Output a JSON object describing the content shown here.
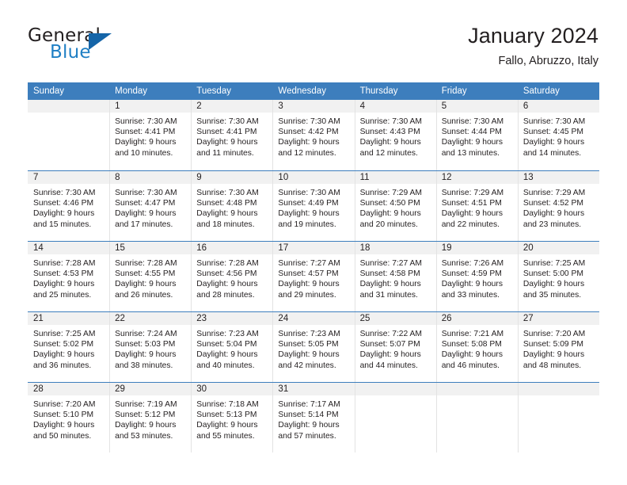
{
  "brand": {
    "name_part1": "General",
    "name_part2": "Blue",
    "triangle_color": "#1565a8",
    "blue_color": "#1f7fc4"
  },
  "header": {
    "title": "January 2024",
    "subtitle": "Fallo, Abruzzo, Italy"
  },
  "theme": {
    "header_blue": "#3d7ebd",
    "numbar_gray": "#f1f1f1",
    "text": "#231f20"
  },
  "weekday_headers": [
    "Sunday",
    "Monday",
    "Tuesday",
    "Wednesday",
    "Thursday",
    "Friday",
    "Saturday"
  ],
  "weeks": [
    [
      {
        "day": "",
        "sunrise": "",
        "sunset": "",
        "daylight1": "",
        "daylight2": ""
      },
      {
        "day": "1",
        "sunrise": "Sunrise: 7:30 AM",
        "sunset": "Sunset: 4:41 PM",
        "daylight1": "Daylight: 9 hours",
        "daylight2": "and 10 minutes."
      },
      {
        "day": "2",
        "sunrise": "Sunrise: 7:30 AM",
        "sunset": "Sunset: 4:41 PM",
        "daylight1": "Daylight: 9 hours",
        "daylight2": "and 11 minutes."
      },
      {
        "day": "3",
        "sunrise": "Sunrise: 7:30 AM",
        "sunset": "Sunset: 4:42 PM",
        "daylight1": "Daylight: 9 hours",
        "daylight2": "and 12 minutes."
      },
      {
        "day": "4",
        "sunrise": "Sunrise: 7:30 AM",
        "sunset": "Sunset: 4:43 PM",
        "daylight1": "Daylight: 9 hours",
        "daylight2": "and 12 minutes."
      },
      {
        "day": "5",
        "sunrise": "Sunrise: 7:30 AM",
        "sunset": "Sunset: 4:44 PM",
        "daylight1": "Daylight: 9 hours",
        "daylight2": "and 13 minutes."
      },
      {
        "day": "6",
        "sunrise": "Sunrise: 7:30 AM",
        "sunset": "Sunset: 4:45 PM",
        "daylight1": "Daylight: 9 hours",
        "daylight2": "and 14 minutes."
      }
    ],
    [
      {
        "day": "7",
        "sunrise": "Sunrise: 7:30 AM",
        "sunset": "Sunset: 4:46 PM",
        "daylight1": "Daylight: 9 hours",
        "daylight2": "and 15 minutes."
      },
      {
        "day": "8",
        "sunrise": "Sunrise: 7:30 AM",
        "sunset": "Sunset: 4:47 PM",
        "daylight1": "Daylight: 9 hours",
        "daylight2": "and 17 minutes."
      },
      {
        "day": "9",
        "sunrise": "Sunrise: 7:30 AM",
        "sunset": "Sunset: 4:48 PM",
        "daylight1": "Daylight: 9 hours",
        "daylight2": "and 18 minutes."
      },
      {
        "day": "10",
        "sunrise": "Sunrise: 7:30 AM",
        "sunset": "Sunset: 4:49 PM",
        "daylight1": "Daylight: 9 hours",
        "daylight2": "and 19 minutes."
      },
      {
        "day": "11",
        "sunrise": "Sunrise: 7:29 AM",
        "sunset": "Sunset: 4:50 PM",
        "daylight1": "Daylight: 9 hours",
        "daylight2": "and 20 minutes."
      },
      {
        "day": "12",
        "sunrise": "Sunrise: 7:29 AM",
        "sunset": "Sunset: 4:51 PM",
        "daylight1": "Daylight: 9 hours",
        "daylight2": "and 22 minutes."
      },
      {
        "day": "13",
        "sunrise": "Sunrise: 7:29 AM",
        "sunset": "Sunset: 4:52 PM",
        "daylight1": "Daylight: 9 hours",
        "daylight2": "and 23 minutes."
      }
    ],
    [
      {
        "day": "14",
        "sunrise": "Sunrise: 7:28 AM",
        "sunset": "Sunset: 4:53 PM",
        "daylight1": "Daylight: 9 hours",
        "daylight2": "and 25 minutes."
      },
      {
        "day": "15",
        "sunrise": "Sunrise: 7:28 AM",
        "sunset": "Sunset: 4:55 PM",
        "daylight1": "Daylight: 9 hours",
        "daylight2": "and 26 minutes."
      },
      {
        "day": "16",
        "sunrise": "Sunrise: 7:28 AM",
        "sunset": "Sunset: 4:56 PM",
        "daylight1": "Daylight: 9 hours",
        "daylight2": "and 28 minutes."
      },
      {
        "day": "17",
        "sunrise": "Sunrise: 7:27 AM",
        "sunset": "Sunset: 4:57 PM",
        "daylight1": "Daylight: 9 hours",
        "daylight2": "and 29 minutes."
      },
      {
        "day": "18",
        "sunrise": "Sunrise: 7:27 AM",
        "sunset": "Sunset: 4:58 PM",
        "daylight1": "Daylight: 9 hours",
        "daylight2": "and 31 minutes."
      },
      {
        "day": "19",
        "sunrise": "Sunrise: 7:26 AM",
        "sunset": "Sunset: 4:59 PM",
        "daylight1": "Daylight: 9 hours",
        "daylight2": "and 33 minutes."
      },
      {
        "day": "20",
        "sunrise": "Sunrise: 7:25 AM",
        "sunset": "Sunset: 5:00 PM",
        "daylight1": "Daylight: 9 hours",
        "daylight2": "and 35 minutes."
      }
    ],
    [
      {
        "day": "21",
        "sunrise": "Sunrise: 7:25 AM",
        "sunset": "Sunset: 5:02 PM",
        "daylight1": "Daylight: 9 hours",
        "daylight2": "and 36 minutes."
      },
      {
        "day": "22",
        "sunrise": "Sunrise: 7:24 AM",
        "sunset": "Sunset: 5:03 PM",
        "daylight1": "Daylight: 9 hours",
        "daylight2": "and 38 minutes."
      },
      {
        "day": "23",
        "sunrise": "Sunrise: 7:23 AM",
        "sunset": "Sunset: 5:04 PM",
        "daylight1": "Daylight: 9 hours",
        "daylight2": "and 40 minutes."
      },
      {
        "day": "24",
        "sunrise": "Sunrise: 7:23 AM",
        "sunset": "Sunset: 5:05 PM",
        "daylight1": "Daylight: 9 hours",
        "daylight2": "and 42 minutes."
      },
      {
        "day": "25",
        "sunrise": "Sunrise: 7:22 AM",
        "sunset": "Sunset: 5:07 PM",
        "daylight1": "Daylight: 9 hours",
        "daylight2": "and 44 minutes."
      },
      {
        "day": "26",
        "sunrise": "Sunrise: 7:21 AM",
        "sunset": "Sunset: 5:08 PM",
        "daylight1": "Daylight: 9 hours",
        "daylight2": "and 46 minutes."
      },
      {
        "day": "27",
        "sunrise": "Sunrise: 7:20 AM",
        "sunset": "Sunset: 5:09 PM",
        "daylight1": "Daylight: 9 hours",
        "daylight2": "and 48 minutes."
      }
    ],
    [
      {
        "day": "28",
        "sunrise": "Sunrise: 7:20 AM",
        "sunset": "Sunset: 5:10 PM",
        "daylight1": "Daylight: 9 hours",
        "daylight2": "and 50 minutes."
      },
      {
        "day": "29",
        "sunrise": "Sunrise: 7:19 AM",
        "sunset": "Sunset: 5:12 PM",
        "daylight1": "Daylight: 9 hours",
        "daylight2": "and 53 minutes."
      },
      {
        "day": "30",
        "sunrise": "Sunrise: 7:18 AM",
        "sunset": "Sunset: 5:13 PM",
        "daylight1": "Daylight: 9 hours",
        "daylight2": "and 55 minutes."
      },
      {
        "day": "31",
        "sunrise": "Sunrise: 7:17 AM",
        "sunset": "Sunset: 5:14 PM",
        "daylight1": "Daylight: 9 hours",
        "daylight2": "and 57 minutes."
      },
      {
        "day": "",
        "sunrise": "",
        "sunset": "",
        "daylight1": "",
        "daylight2": ""
      },
      {
        "day": "",
        "sunrise": "",
        "sunset": "",
        "daylight1": "",
        "daylight2": ""
      },
      {
        "day": "",
        "sunrise": "",
        "sunset": "",
        "daylight1": "",
        "daylight2": ""
      }
    ]
  ]
}
